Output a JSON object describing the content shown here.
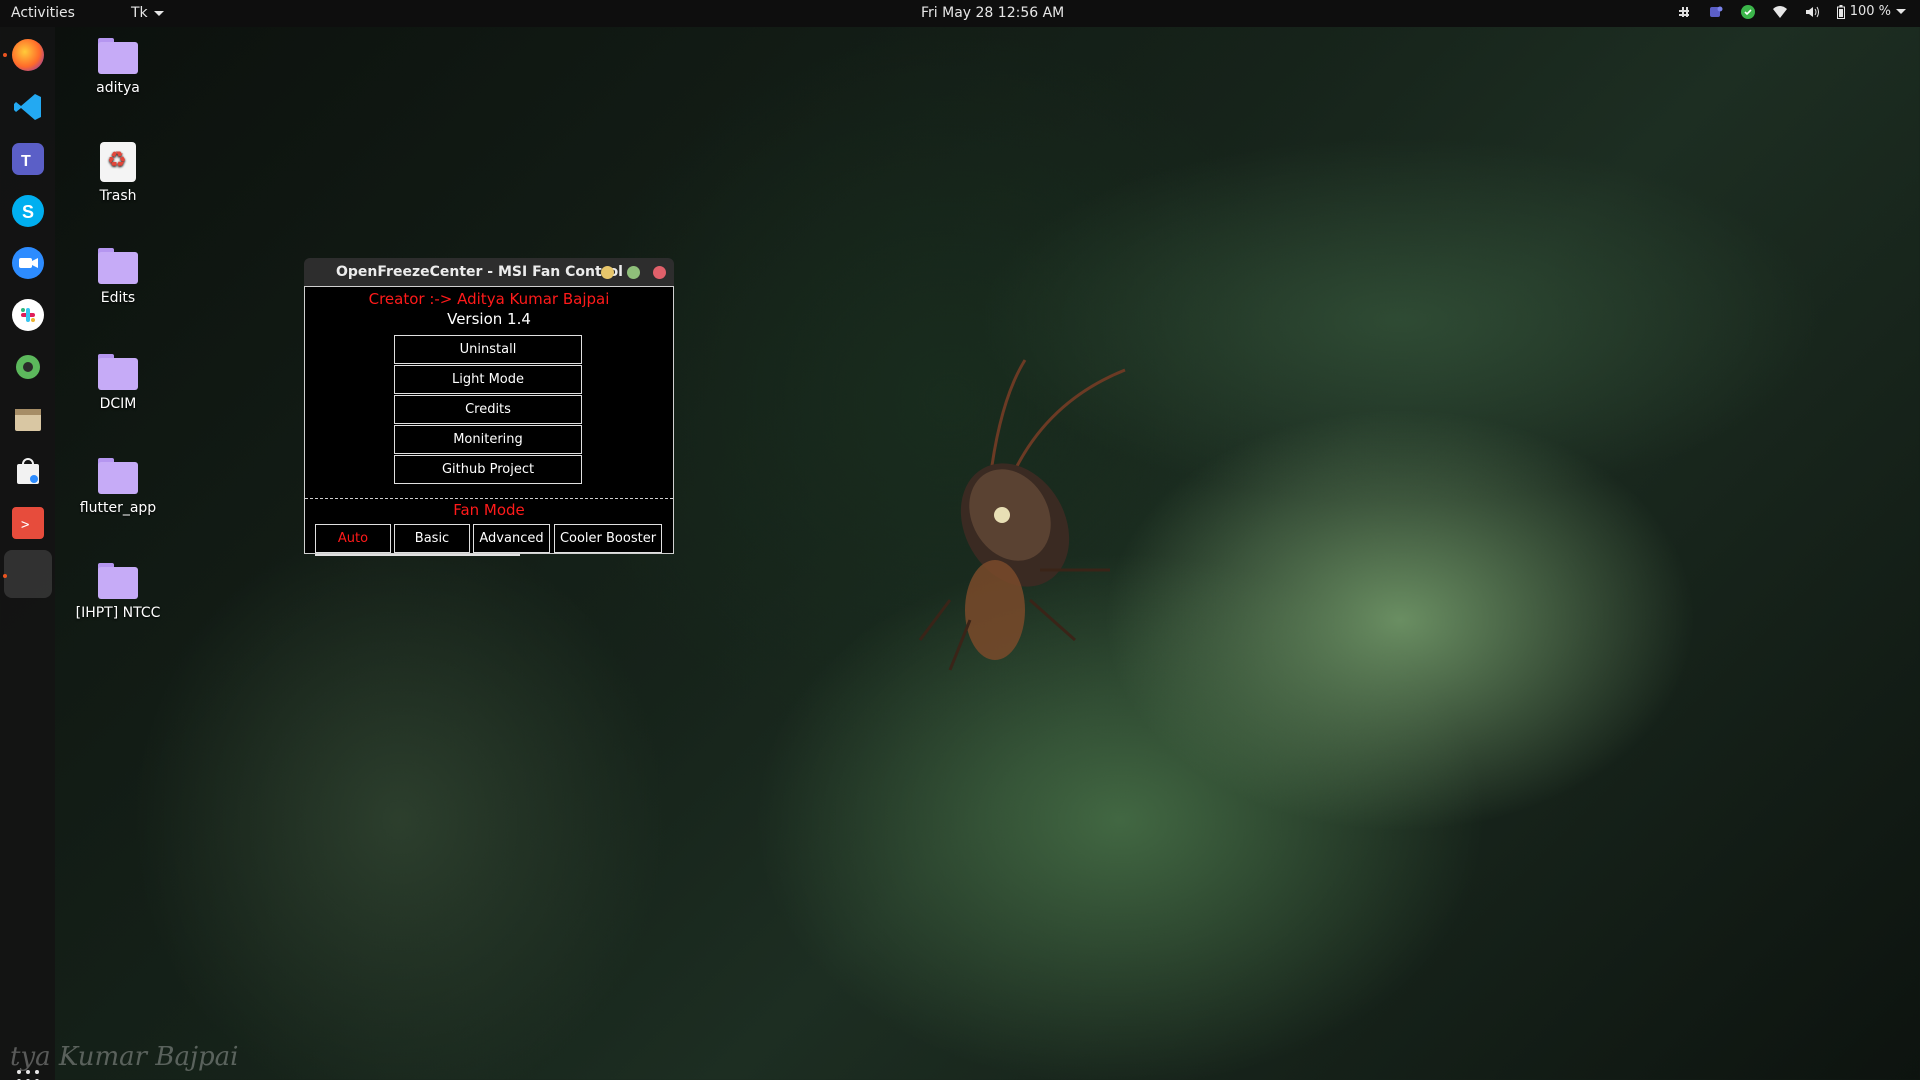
{
  "topbar": {
    "activities": "Activities",
    "app_name": "Tk",
    "clock": "Fri May 28  12:56 AM",
    "battery": "100 %"
  },
  "dock": {
    "items": [
      "firefox-icon",
      "vscode-icon",
      "teams-icon",
      "skype-icon",
      "zoom-icon",
      "slack-icon",
      "settings-icon",
      "files-icon",
      "software-icon",
      "terminal-icon",
      "tk-app-icon"
    ]
  },
  "desktop": {
    "icons": [
      {
        "label": "aditya",
        "type": "home"
      },
      {
        "label": "Trash",
        "type": "trash"
      },
      {
        "label": "Edits",
        "type": "folder"
      },
      {
        "label": "DCIM",
        "type": "folder"
      },
      {
        "label": "flutter_app",
        "type": "folder"
      },
      {
        "label": "[IHPT] NTCC",
        "type": "folder"
      }
    ]
  },
  "window": {
    "title": "OpenFreezeCenter - MSI Fan Control",
    "creator": "Creator :-> Aditya Kumar Bajpai",
    "version": "Version 1.4",
    "menu": [
      "Uninstall",
      "Light Mode",
      "Credits",
      "Monitering",
      "Github Project"
    ],
    "fan_mode_label": "Fan Mode",
    "modes": [
      "Auto",
      "Basic",
      "Advanced",
      "Cooler Booster"
    ],
    "active_mode": "Auto"
  },
  "watermark": "tya Kumar Bajpai",
  "colors": {
    "accent_red": "#ff1a1a",
    "folder_purple": "#c6abf7",
    "ubuntu_orange": "#e95420"
  }
}
